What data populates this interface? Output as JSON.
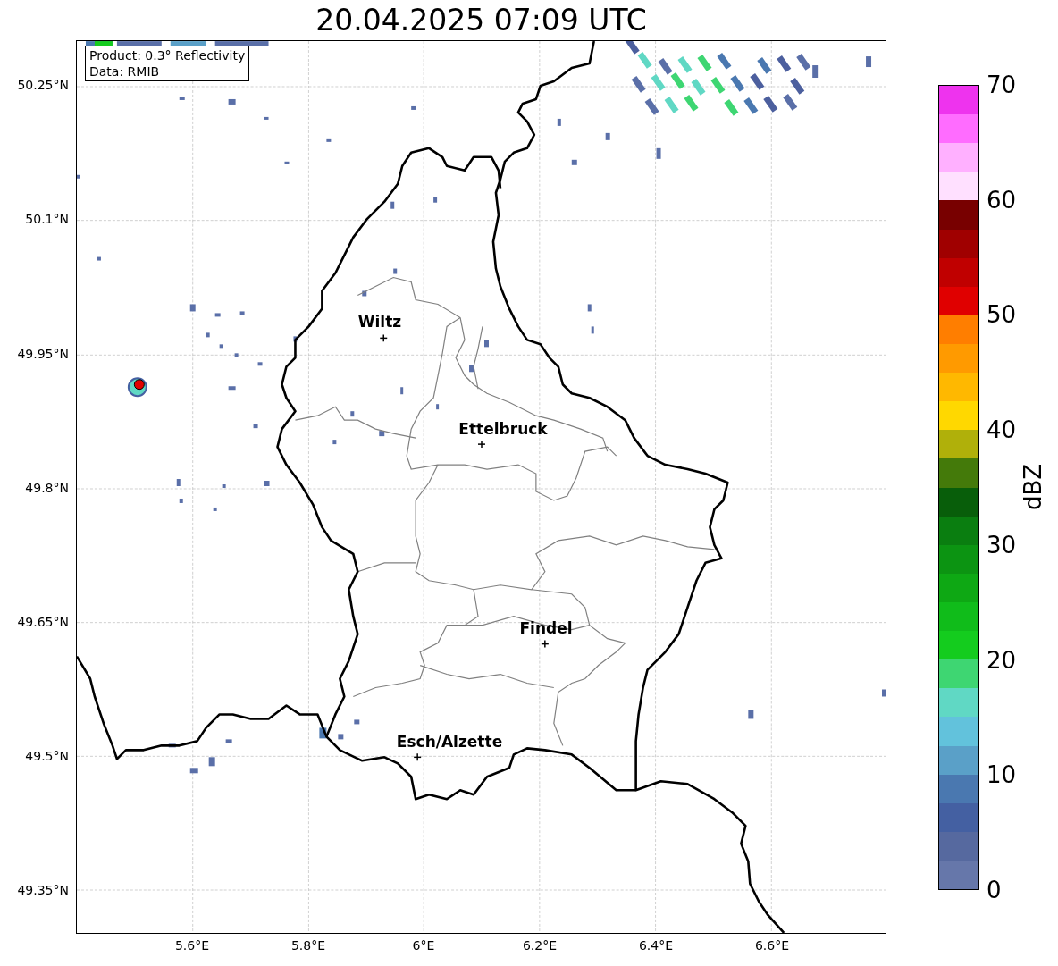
{
  "title": "20.04.2025 07:09 UTC",
  "info_box": {
    "lines": [
      "Product: 0.3° Reflectivity",
      "Data: RMIB"
    ]
  },
  "map": {
    "cities": [
      {
        "name": "Wiltz"
      },
      {
        "name": "Ettelbruck"
      },
      {
        "name": "Findel"
      },
      {
        "name": "Esch/Alzette"
      }
    ],
    "x_ticks": [
      "5.6°E",
      "5.8°E",
      "6°E",
      "6.2°E",
      "6.4°E",
      "6.6°E"
    ],
    "y_ticks": [
      "50.25°N",
      "50.1°N",
      "49.95°N",
      "49.8°N",
      "49.65°N",
      "49.5°N",
      "49.35°N"
    ]
  },
  "colorbar": {
    "label": "dBZ",
    "ticks": [
      "70",
      "60",
      "50",
      "40",
      "30",
      "20",
      "10",
      "0"
    ],
    "bins": [
      {
        "color": "#ee33ee"
      },
      {
        "color": "#ff6cff"
      },
      {
        "color": "#ffb0ff"
      },
      {
        "color": "#ffe0ff"
      },
      {
        "color": "#780000"
      },
      {
        "color": "#a00000"
      },
      {
        "color": "#c00000"
      },
      {
        "color": "#e00000"
      },
      {
        "color": "#ff7e00"
      },
      {
        "color": "#ff9a00"
      },
      {
        "color": "#ffb800"
      },
      {
        "color": "#ffd800"
      },
      {
        "color": "#b0b00a"
      },
      {
        "color": "#447a0a"
      },
      {
        "color": "#085e0a"
      },
      {
        "color": "#0a7e10"
      },
      {
        "color": "#0c9412"
      },
      {
        "color": "#0ea814"
      },
      {
        "color": "#10bc1a"
      },
      {
        "color": "#14cc1e"
      },
      {
        "color": "#3ed672"
      },
      {
        "color": "#60d8c4"
      },
      {
        "color": "#62c2dc"
      },
      {
        "color": "#5aa0c8"
      },
      {
        "color": "#4a78b0"
      },
      {
        "color": "#4460a2"
      },
      {
        "color": "#56699f"
      },
      {
        "color": "#6677aa"
      }
    ]
  }
}
